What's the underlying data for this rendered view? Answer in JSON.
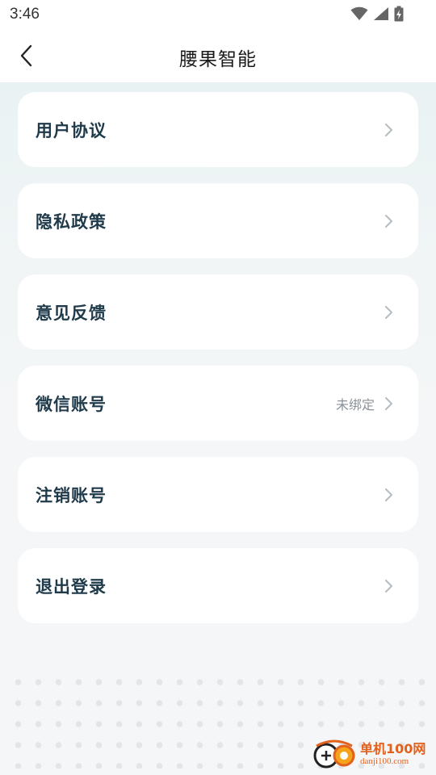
{
  "status_bar": {
    "time": "3:46",
    "icons": [
      "wifi-icon",
      "signal-icon",
      "battery-charging-icon"
    ]
  },
  "header": {
    "title": "腰果智能",
    "back_icon": "chevron-left-icon"
  },
  "menu": {
    "items": [
      {
        "label": "用户协议",
        "value": ""
      },
      {
        "label": "隐私政策",
        "value": ""
      },
      {
        "label": "意见反馈",
        "value": ""
      },
      {
        "label": "微信账号",
        "value": "未绑定"
      },
      {
        "label": "注销账号",
        "value": ""
      },
      {
        "label": "退出登录",
        "value": ""
      }
    ]
  },
  "watermark": {
    "name": "单机100网",
    "url": "danji100.com"
  },
  "colors": {
    "accent_text": "#1f3a4a",
    "secondary_text": "#8a9298",
    "chevron": "#b5bcc1",
    "watermark": "#e2611d"
  }
}
